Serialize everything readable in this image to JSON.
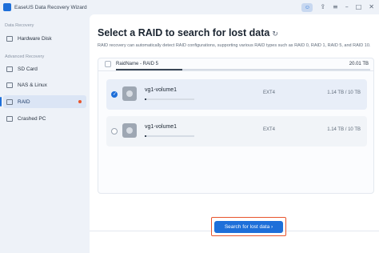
{
  "app": {
    "title": "EaseUS Data Recovery Wizard"
  },
  "sidebar": {
    "sections": [
      {
        "label": "Data Recovery"
      },
      {
        "label": "Advanced Recovery"
      }
    ],
    "items": [
      {
        "label": "Hardware Disk",
        "icon": "hard-disk-icon"
      },
      {
        "label": "SD Card",
        "icon": "sd-card-icon"
      },
      {
        "label": "NAS & Linux",
        "icon": "nas-icon"
      },
      {
        "label": "RAID",
        "icon": "raid-icon",
        "active": true,
        "has_dot": true
      },
      {
        "label": "Crashed PC",
        "icon": "crashed-pc-icon"
      }
    ]
  },
  "topbar": {
    "icons": [
      "avatar-icon",
      "upgrade-icon",
      "menu-icon",
      "minimize-icon",
      "maximize-icon",
      "close-icon"
    ]
  },
  "main": {
    "title": "Select a RAID to search for lost data",
    "description": "RAID recovery can automatically detect RAID configurations, supporting various RAID types such as RAID 0, RAID 1, RAID 5, and RAID 10.",
    "raid": {
      "name": "RaidName - RAID 5",
      "size": "20.01 TB",
      "used_fraction": 0.26
    },
    "volumes": [
      {
        "name": "vg1-volume1",
        "fs": "EXT4",
        "capacity": "1.14 TB / 10 TB",
        "selected": true,
        "used_fraction": 0.03
      },
      {
        "name": "vg1-volume1",
        "fs": "EXT4",
        "capacity": "1.14 TB / 10 TB",
        "selected": false,
        "used_fraction": 0.03
      }
    ],
    "cta": "Search for lost data ›"
  },
  "colors": {
    "accent": "#1e6fd9",
    "highlight": "#e8552d"
  }
}
